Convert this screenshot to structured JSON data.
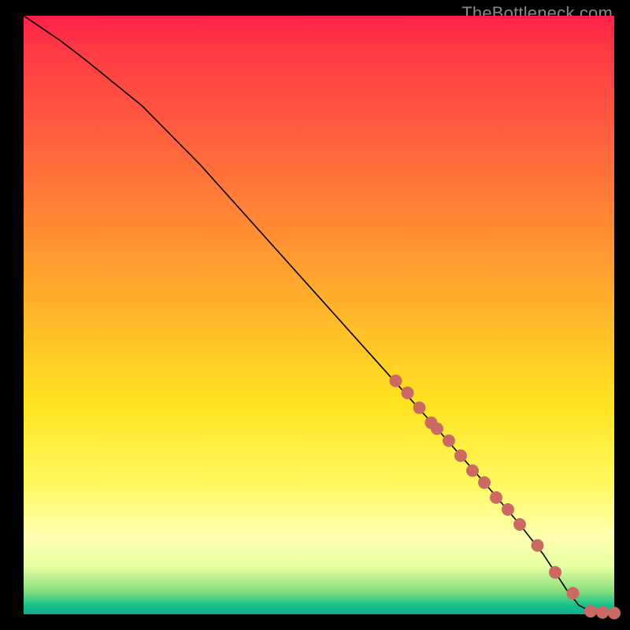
{
  "watermark": "TheBottleneck.com",
  "colors": {
    "page_bg": "#000000",
    "marker": "#cb6a63",
    "curve": "#000000",
    "gradient_top": "#ff1f4a",
    "gradient_bottom": "#0fae8e"
  },
  "chart_data": {
    "type": "line",
    "title": "",
    "xlabel": "",
    "ylabel": "",
    "xlim": [
      0,
      100
    ],
    "ylim": [
      0,
      100
    ],
    "gridlines": false,
    "legend": false,
    "series": [
      {
        "name": "curve",
        "x": [
          0,
          3,
          6,
          10,
          15,
          20,
          30,
          40,
          50,
          60,
          70,
          78,
          84,
          88,
          90,
          92,
          94,
          96,
          98,
          100
        ],
        "y": [
          100,
          98,
          96,
          93,
          89,
          85,
          75,
          64,
          53,
          42,
          31,
          22,
          15,
          10,
          7,
          4,
          1.5,
          0.5,
          0.3,
          0.2
        ]
      }
    ],
    "markers": {
      "name": "highlighted-points",
      "x": [
        63,
        65,
        67,
        69,
        70,
        72,
        74,
        76,
        78,
        80,
        82,
        84,
        87,
        90,
        93,
        96,
        98,
        100
      ],
      "y": [
        39,
        37,
        34.5,
        32,
        31,
        29,
        26.5,
        24,
        22,
        19.5,
        17.5,
        15,
        11.5,
        7,
        3.5,
        0.5,
        0.3,
        0.2
      ]
    }
  }
}
